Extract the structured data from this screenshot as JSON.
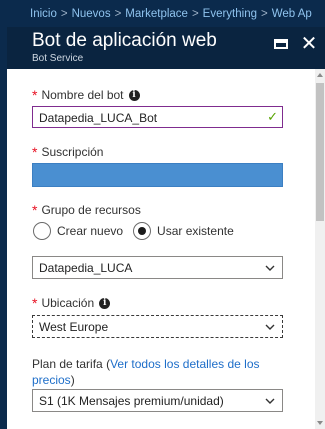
{
  "breadcrumb": [
    "Inicio",
    "Nuevos",
    "Marketplace",
    "Everything",
    "Web Ap"
  ],
  "breadcrumb_separator": ">",
  "blade": {
    "title": "Bot de aplicación web",
    "subtitle": "Bot Service",
    "maximize_icon": "maximize-icon",
    "close_label": "✕"
  },
  "form": {
    "bot_name": {
      "label": "Nombre del bot",
      "required_mark": "*",
      "value": "Datapedia_LUCA_Bot",
      "valid": true
    },
    "subscription": {
      "label": "Suscripción",
      "required_mark": "*"
    },
    "resource_group": {
      "label": "Grupo de recursos",
      "required_mark": "*",
      "options": [
        "Crear nuevo",
        "Usar existente"
      ],
      "selected_option": "Usar existente",
      "value": "Datapedia_LUCA"
    },
    "location": {
      "label": "Ubicación",
      "required_mark": "*",
      "value": "West Europe"
    },
    "pricing_plan": {
      "label": "Plan de tarifa",
      "link_text": "Ver todos los detalles de los precios",
      "open_paren": "(",
      "close_paren": ")",
      "value": "S1 (1K Mensajes premium/unidad)"
    }
  },
  "colors": {
    "header_bg": "#0a2440",
    "breadcrumb_bg": "#0b2a4c",
    "required": "#e81123",
    "link": "#1e6ec9",
    "valid_check": "#57a300",
    "subscription_fill": "#4a8fd1"
  }
}
